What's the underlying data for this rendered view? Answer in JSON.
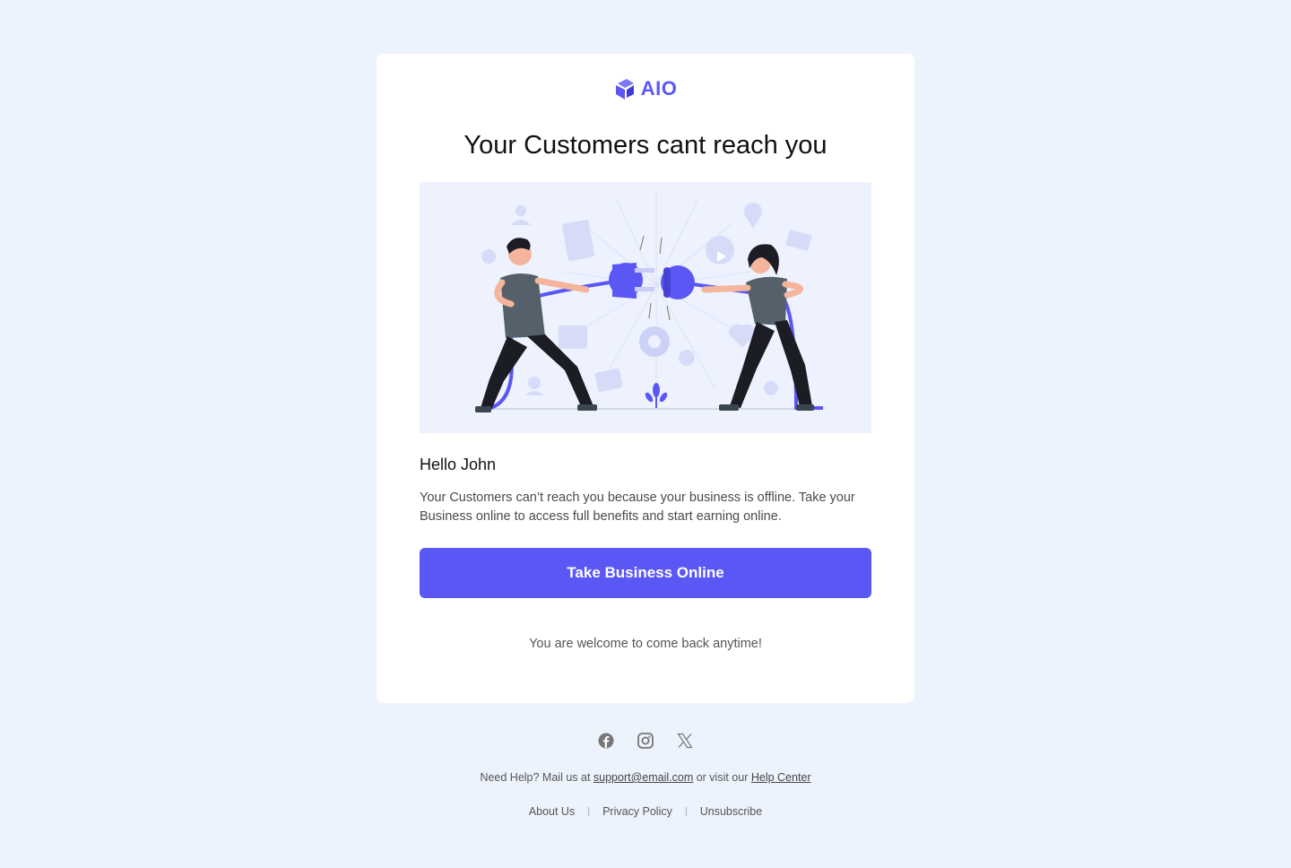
{
  "brand": {
    "name": "AIO",
    "accent": "#5B57F5",
    "background": "#EDF3FD"
  },
  "email": {
    "headline": "Your Customers cant reach you",
    "hero_image": "two-people-pulling-unplugged-cable-illustration",
    "greeting": "Hello John",
    "body": "Your Customers can’t reach you because your business is offline. Take your Business online to access full benefits and start earning online.",
    "cta_label": "Take Business Online",
    "closing": "You are welcome to come back anytime!"
  },
  "footer": {
    "social_icons": [
      "facebook-icon",
      "instagram-icon",
      "x-icon"
    ],
    "help_prefix": "Need Help? Mail us at ",
    "help_email": "support@email.com",
    "help_middle": " or visit our ",
    "help_center": "Help Center",
    "links": [
      "About Us",
      "Privacy Policy",
      "Unsubscribe"
    ],
    "separator": "|"
  }
}
